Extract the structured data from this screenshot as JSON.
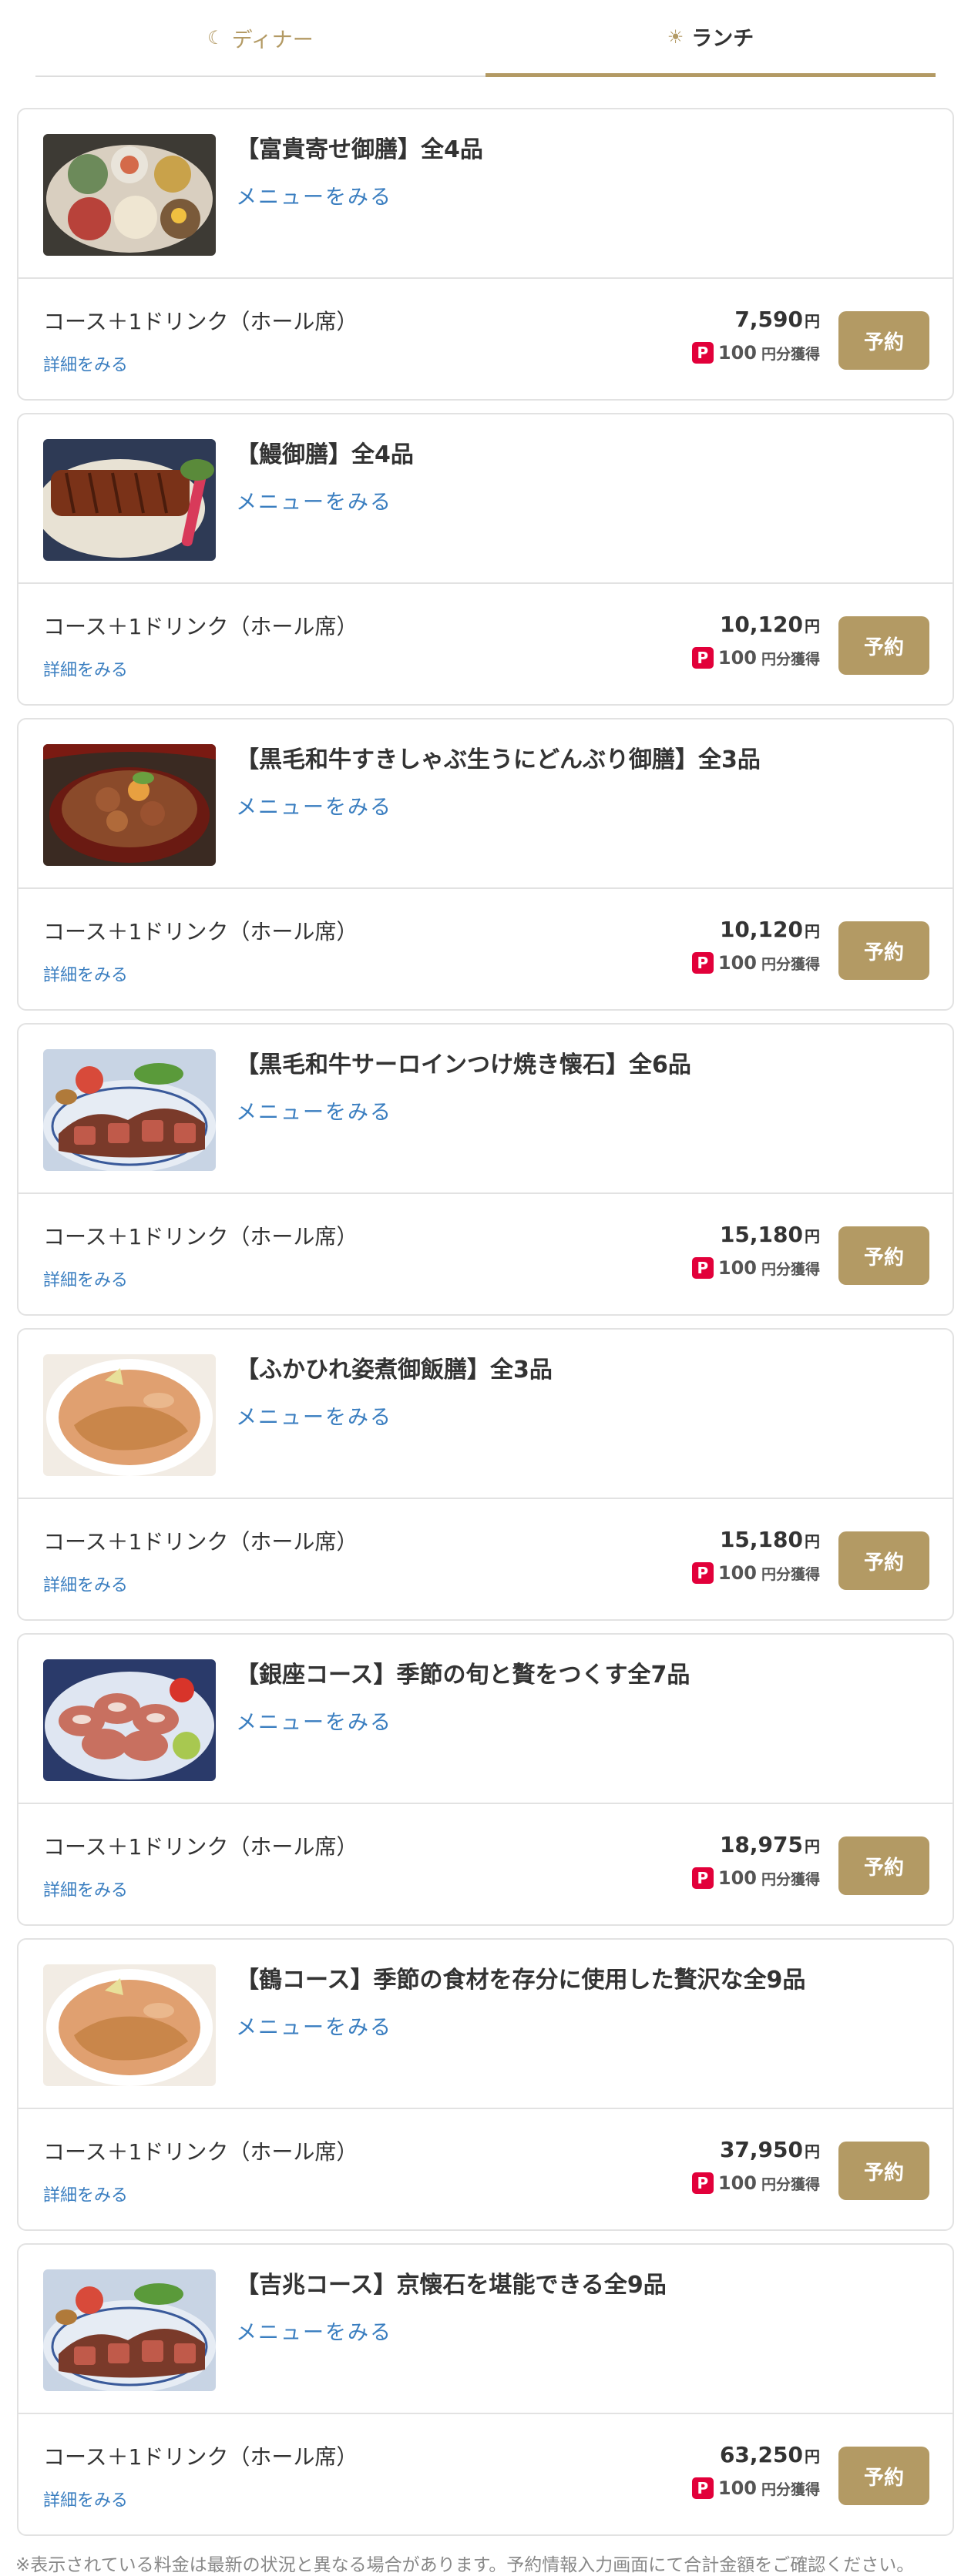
{
  "tabs": [
    {
      "label": "ディナー",
      "icon": "moon-icon",
      "active": false
    },
    {
      "label": "ランチ",
      "icon": "sun-icon",
      "active": true
    }
  ],
  "colors": {
    "accent": "#b39a64",
    "link": "#3a7ec0",
    "paypay": "#e2003a"
  },
  "courses": [
    {
      "title": "【富貴寄せ御膳】全4品",
      "menu_link": "メニューをみる",
      "plan": "コース＋1ドリンク（ホール席）",
      "detail_link": "詳細をみる",
      "price": "7,590",
      "currency": "円",
      "points": "100",
      "points_unit": "円分獲得",
      "reserve": "予約",
      "image": "bento-tray-image"
    },
    {
      "title": "【鰻御膳】全4品",
      "menu_link": "メニューをみる",
      "plan": "コース＋1ドリンク（ホール席）",
      "detail_link": "詳細をみる",
      "price": "10,120",
      "currency": "円",
      "points": "100",
      "points_unit": "円分獲得",
      "reserve": "予約",
      "image": "grilled-eel-image"
    },
    {
      "title": "【黒毛和牛すきしゃぶ生うにどんぶり御膳】全3品",
      "menu_link": "メニューをみる",
      "plan": "コース＋1ドリンク（ホール席）",
      "detail_link": "詳細をみる",
      "price": "10,120",
      "currency": "円",
      "points": "100",
      "points_unit": "円分獲得",
      "reserve": "予約",
      "image": "beef-donburi-image"
    },
    {
      "title": "【黒毛和牛サーロインつけ焼き懐石】全6品",
      "menu_link": "メニューをみる",
      "plan": "コース＋1ドリンク（ホール席）",
      "detail_link": "詳細をみる",
      "price": "15,180",
      "currency": "円",
      "points": "100",
      "points_unit": "円分獲得",
      "reserve": "予約",
      "image": "sirloin-steak-image"
    },
    {
      "title": "【ふかひれ姿煮御飯膳】全3品",
      "menu_link": "メニューをみる",
      "plan": "コース＋1ドリンク（ホール席）",
      "detail_link": "詳細をみる",
      "price": "15,180",
      "currency": "円",
      "points": "100",
      "points_unit": "円分獲得",
      "reserve": "予約",
      "image": "shark-fin-soup-image"
    },
    {
      "title": "【銀座コース】季節の旬と贅をつくす全7品",
      "menu_link": "メニューをみる",
      "plan": "コース＋1ドリンク（ホール席）",
      "detail_link": "詳細をみる",
      "price": "18,975",
      "currency": "円",
      "points": "100",
      "points_unit": "円分獲得",
      "reserve": "予約",
      "image": "beef-rolls-image"
    },
    {
      "title": "【鶴コース】季節の食材を存分に使用した贅沢な全9品",
      "menu_link": "メニューをみる",
      "plan": "コース＋1ドリンク（ホール席）",
      "detail_link": "詳細をみる",
      "price": "37,950",
      "currency": "円",
      "points": "100",
      "points_unit": "円分獲得",
      "reserve": "予約",
      "image": "shark-fin-soup-image"
    },
    {
      "title": "【吉兆コース】京懐石を堪能できる全9品",
      "menu_link": "メニューをみる",
      "plan": "コース＋1ドリンク（ホール席）",
      "detail_link": "詳細をみる",
      "price": "63,250",
      "currency": "円",
      "points": "100",
      "points_unit": "円分獲得",
      "reserve": "予約",
      "image": "sirloin-steak-image"
    }
  ],
  "footer_note": "※表示されている料金は最新の状況と異なる場合があります。予約情報入力画面にて合計金額をご確認ください。"
}
